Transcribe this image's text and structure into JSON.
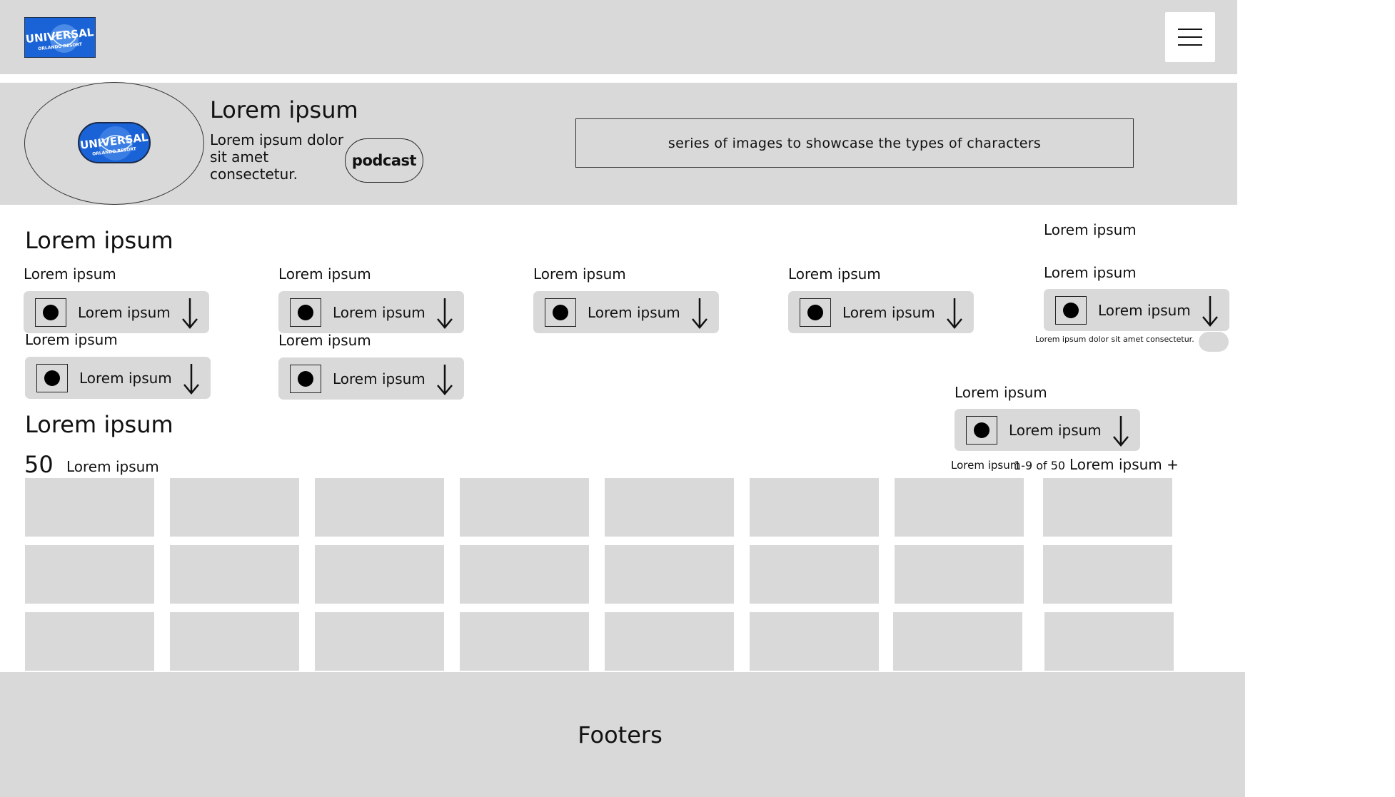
{
  "header": {
    "logo_text_main": "UNIVERSAL",
    "logo_text_sub": "ORLANDO RESORT",
    "menu_icon": "hamburger-menu-icon"
  },
  "hero": {
    "logo_text_main": "UNIVERSAL",
    "logo_text_sub": "ORLANDO RESORT",
    "title": "Lorem ipsum",
    "description": "Lorem ipsum dolor sit amet consectetur.",
    "podcast_label": "podcast",
    "images_placeholder": "series of images to showcase the types of characters"
  },
  "filters": {
    "section_title": "Lorem ipsum",
    "top_right_label": "Lorem ipsum",
    "groups": [
      {
        "label": "Lorem ipsum",
        "dropdown": "Lorem ipsum"
      },
      {
        "label": "Lorem ipsum",
        "dropdown": "Lorem ipsum"
      },
      {
        "label": "Lorem ipsum",
        "dropdown": "Lorem ipsum"
      },
      {
        "label": "Lorem ipsum",
        "dropdown": "Lorem ipsum"
      },
      {
        "label": "Lorem ipsum",
        "dropdown": "Lorem ipsum"
      },
      {
        "label": "Lorem ipsum",
        "dropdown": "Lorem ipsum"
      },
      {
        "label": "Lorem ipsum",
        "dropdown": "Lorem ipsum"
      },
      {
        "label": "Lorem ipsum",
        "dropdown": "Lorem ipsum"
      }
    ],
    "small_note": "Lorem ipsum dolor sit amet consectetur."
  },
  "results": {
    "section_title": "Lorem ipsum",
    "count": "50",
    "count_label": "Lorem ipsum",
    "pager_label": "Lorem ipsum",
    "pager_range": "1-9 of 50",
    "pager_more": "Lorem ipsum +"
  },
  "footer": {
    "text": "Footers"
  },
  "colors": {
    "panel_gray": "#d9d9d9",
    "logo_blue": "#1a63d6"
  }
}
